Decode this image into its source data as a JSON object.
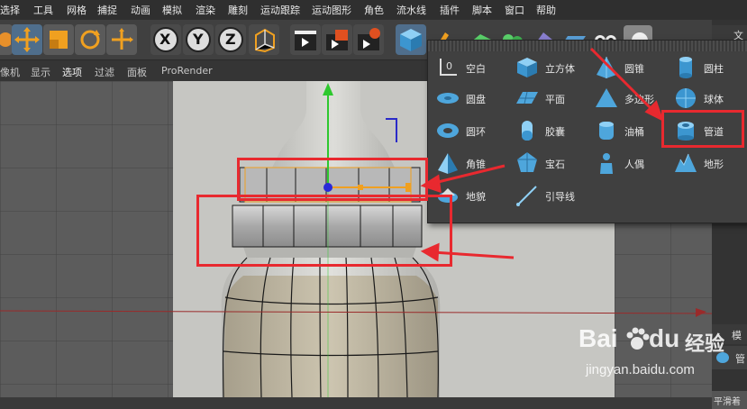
{
  "menubar": {
    "items": [
      "选择",
      "工具",
      "网格",
      "捕捉",
      "动画",
      "模拟",
      "渲染",
      "雕刻",
      "运动跟踪",
      "运动图形",
      "角色",
      "流水线",
      "插件",
      "脚本",
      "窗口",
      "帮助"
    ]
  },
  "toolbar": {
    "axis_x": "X",
    "axis_y": "Y",
    "axis_z": "Z"
  },
  "viewport_menu": {
    "items": [
      "像机",
      "显示",
      "选项",
      "过滤",
      "面板",
      "ProRender"
    ]
  },
  "right_panel": {
    "tab_top": "文",
    "tab_bottom": "模",
    "field": "管",
    "subfield": "平滑着"
  },
  "primitive_popup": {
    "items": [
      {
        "label": "空白",
        "icon": "null-object-icon"
      },
      {
        "label": "立方体",
        "icon": "cube-icon"
      },
      {
        "label": "圆锥",
        "icon": "cone-icon"
      },
      {
        "label": "圆柱",
        "icon": "cylinder-icon"
      },
      {
        "label": "圆盘",
        "icon": "disc-icon"
      },
      {
        "label": "平面",
        "icon": "plane-icon"
      },
      {
        "label": "多边形",
        "icon": "polygon-icon"
      },
      {
        "label": "球体",
        "icon": "sphere-icon"
      },
      {
        "label": "圆环",
        "icon": "torus-icon"
      },
      {
        "label": "胶囊",
        "icon": "capsule-icon"
      },
      {
        "label": "油桶",
        "icon": "oil-tank-icon"
      },
      {
        "label": "管道",
        "icon": "tube-icon"
      },
      {
        "label": "角锥",
        "icon": "pyramid-icon"
      },
      {
        "label": "宝石",
        "icon": "platonic-icon"
      },
      {
        "label": "人偶",
        "icon": "figure-icon"
      },
      {
        "label": "地形",
        "icon": "landscape-icon"
      },
      {
        "label": "地貌",
        "icon": "relief-icon"
      },
      {
        "label": "引导线",
        "icon": "guide-icon"
      }
    ],
    "highlighted": "管道"
  },
  "watermark": {
    "brand": "Bai",
    "brand2": "du",
    "product": "经验",
    "url": "jingyan.baidu.com"
  },
  "colors": {
    "annotation_red": "#e8292f",
    "menubar_bg": "#2f2f2f",
    "viewport_bg": "#5a5a5a",
    "popup_bg": "#404040",
    "icon_blue": "#4ea6dc"
  }
}
